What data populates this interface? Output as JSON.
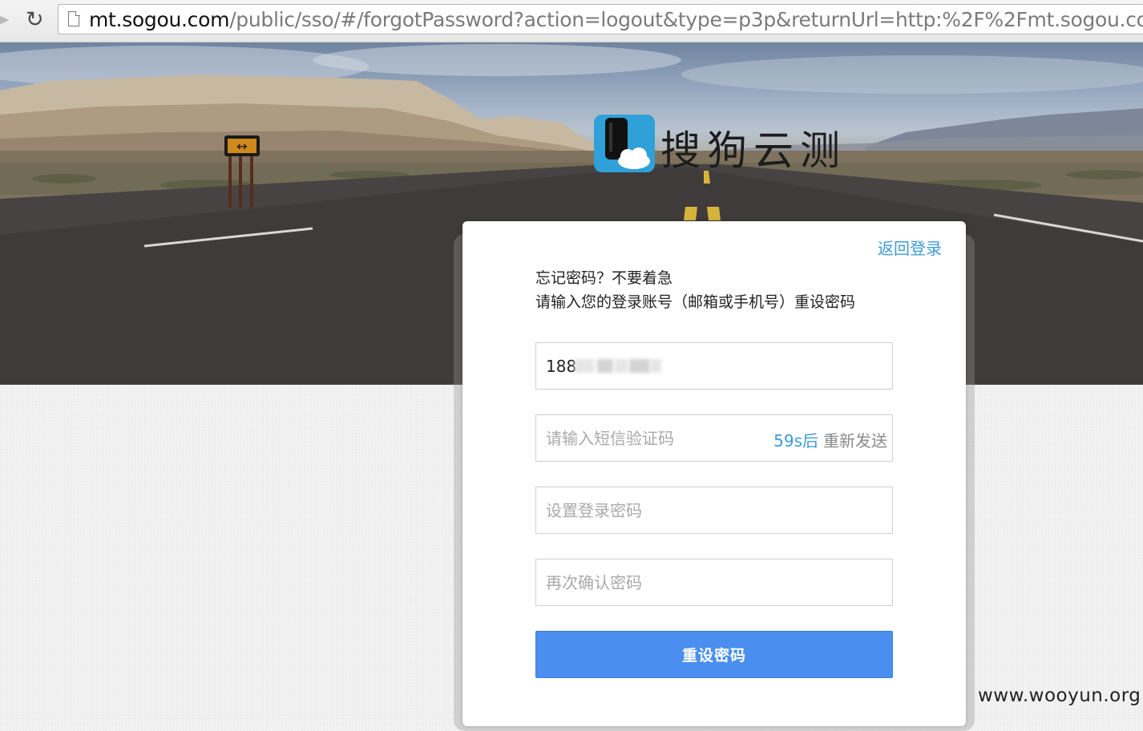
{
  "browser": {
    "url_host": "mt.sogou.com",
    "url_path": "/public/sso/#/forgotPassword?action=logout&type=p3p&returnUrl=http:%2F%2Fmt.sogou.com%2"
  },
  "brand": {
    "name": "搜狗云测",
    "accent_color": "#3d9ad8",
    "button_color": "#4a8ef0"
  },
  "form": {
    "back_link": "返回登录",
    "intro_line1": "忘记密码？不要着急",
    "intro_line2": "请输入您的登录账号（邮箱或手机号）重设密码",
    "account_value": "188",
    "sms_placeholder": "请输入短信验证码",
    "countdown": "59s后",
    "resend_label": "重新发送",
    "password_placeholder": "设置登录密码",
    "confirm_placeholder": "再次确认密码",
    "submit_label": "重设密码"
  },
  "watermark": "www.wooyun.org"
}
